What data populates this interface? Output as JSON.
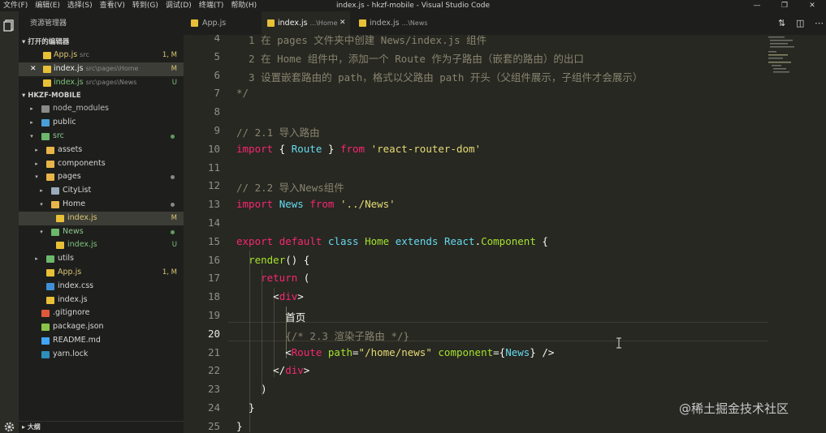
{
  "menu": [
    "文件(F)",
    "编辑(E)",
    "选择(S)",
    "查看(V)",
    "转到(G)",
    "调试(D)",
    "终端(T)",
    "帮助(H)"
  ],
  "window_title": "index.js - hkzf-mobile - Visual Studio Code",
  "sidebar": {
    "title": "资源管理器",
    "open_editors_header": "打开的编辑器",
    "open_editors": [
      {
        "name": "App.js",
        "path": "src",
        "status": "1, M"
      },
      {
        "name": "index.js",
        "path": "src\\pages\\Home",
        "status": "M"
      },
      {
        "name": "index.js",
        "path": "src\\pages\\News",
        "status": "U"
      }
    ],
    "project_header": "HKZF-MOBILE",
    "tree": [
      {
        "label": "node_modules"
      },
      {
        "label": "public"
      },
      {
        "label": "src"
      },
      {
        "label": "assets"
      },
      {
        "label": "components"
      },
      {
        "label": "pages"
      },
      {
        "label": "CityList"
      },
      {
        "label": "Home"
      },
      {
        "label": "index.js",
        "status": "M"
      },
      {
        "label": "News"
      },
      {
        "label": "index.js",
        "status": "U"
      },
      {
        "label": "utils"
      },
      {
        "label": "App.js",
        "status": "1, M"
      },
      {
        "label": "index.css"
      },
      {
        "label": "index.js"
      },
      {
        "label": ".gitignore"
      },
      {
        "label": "package.json"
      },
      {
        "label": "README.md"
      },
      {
        "label": "yarn.lock"
      }
    ],
    "outline_header": "大纲"
  },
  "tabs": [
    {
      "name": "App.js",
      "hint": ""
    },
    {
      "name": "index.js",
      "hint": "...\\Home"
    },
    {
      "name": "index.js",
      "hint": "...\\News"
    }
  ],
  "editor": {
    "line_numbers": [
      "4",
      "5",
      "6",
      "7",
      "8",
      "9",
      "10",
      "11",
      "12",
      "13",
      "14",
      "15",
      "16",
      "17",
      "18",
      "19",
      "20",
      "21",
      "22",
      "23",
      "24",
      "25"
    ],
    "code": {
      "l4": "  1 在 pages 文件夹中创建 News/index.js 组件",
      "l5": "  2 在 Home 组件中，添加一个 Route 作为子路由（嵌套的路由）的出口",
      "l6": "  3 设置嵌套路由的 path，格式以父路由 path 开头（父组件展示，子组件才会展示）",
      "l7": "*/",
      "l9": "// 2.1 导入路由",
      "l13_from": "'../News'",
      "l10_from": "'react-router-dom'",
      "l12": "// 2.2 导入News组件",
      "l19": "首页",
      "l20": "{/* 2.3 渲染子路由 */}",
      "l21_path": "\"/home/news\""
    }
  },
  "watermark": "@稀土掘金技术社区",
  "colors": {
    "editor_bg": "#272822",
    "sidebar_bg": "#1e1f1c",
    "js_icon": "#e8c037",
    "folder_icon": "#e8b54a"
  }
}
